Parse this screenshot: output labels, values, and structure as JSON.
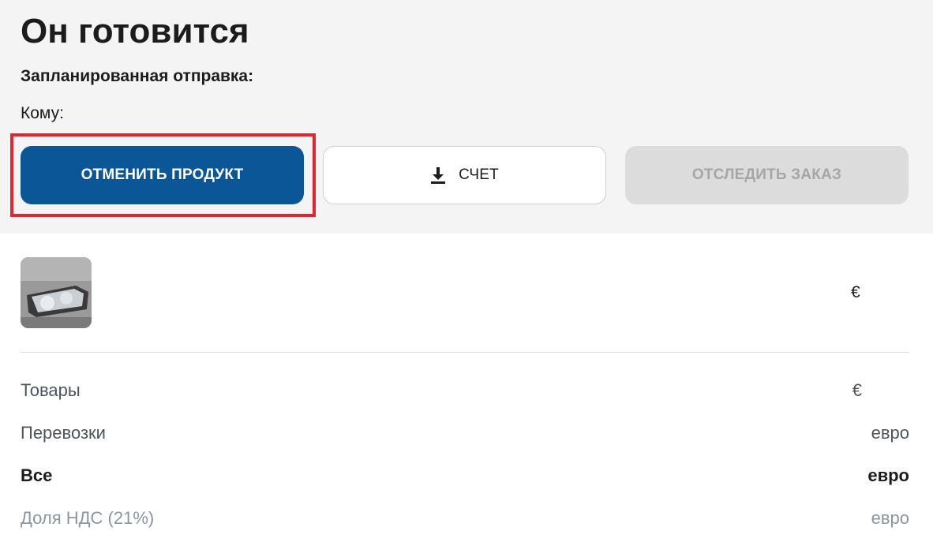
{
  "header": {
    "title": "Он готовится",
    "scheduled_shipping_label": "Запланированная отправка:",
    "to_label": "Кому:"
  },
  "actions": {
    "cancel_label": "ОТМЕНИТЬ ПРОДУКТ",
    "invoice_label": "СЧЕТ",
    "track_label": "ОТСЛЕДИТЬ ЗАКАЗ"
  },
  "product": {
    "price": "€",
    "thumbnail_icon": "headlight-product-image"
  },
  "summary": {
    "goods": {
      "label": "Товары",
      "value": "€"
    },
    "shipping": {
      "label": "Перевозки",
      "value": "евро"
    },
    "total": {
      "label": "Все",
      "value": "евро"
    },
    "vat": {
      "label": "Доля НДС (21%)",
      "value": "евро"
    }
  },
  "colors": {
    "primary": "#0a5696",
    "highlight": "#e3252e",
    "disabled_bg": "#dcdcdc",
    "panel_bg": "#f4f4f4"
  }
}
